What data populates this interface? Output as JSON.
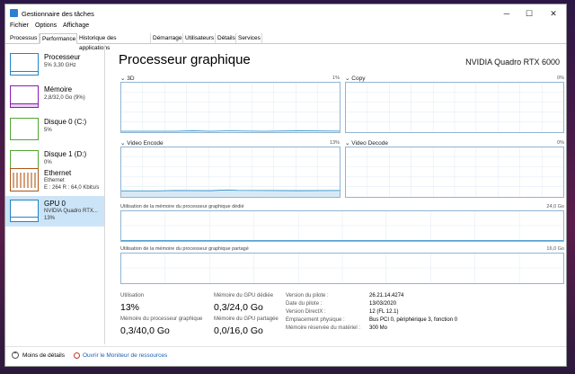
{
  "window": {
    "title": "Gestionnaire des tâches"
  },
  "menu": [
    "Fichier",
    "Options",
    "Affichage"
  ],
  "tabs": [
    "Processus",
    "Performance",
    "Historique des applications",
    "Démarrage",
    "Utilisateurs",
    "Détails",
    "Services"
  ],
  "active_tab": "Performance",
  "sidebar": [
    {
      "name": "Processeur",
      "sub1": "5% 3,30 GHz",
      "sub2": "",
      "sub3": "",
      "color": "#1f86c6"
    },
    {
      "name": "Mémoire",
      "sub1": "2,8/32,0 Go (9%)",
      "sub2": "",
      "sub3": "",
      "color": "#8b1ab8"
    },
    {
      "name": "Disque 0 (C:)",
      "sub1": "5%",
      "sub2": "",
      "sub3": "",
      "color": "#4fa832"
    },
    {
      "name": "Disque 1 (D:)",
      "sub1": "0%",
      "sub2": "",
      "sub3": "",
      "color": "#4fa832"
    },
    {
      "name": "Ethernet",
      "sub1": "Ethernet",
      "sub2": "E : 264 R : 64,0 Kbits/s",
      "sub3": "",
      "color": "#a8561a"
    },
    {
      "name": "GPU 0",
      "sub1": "NVIDIA Quadro RTX...",
      "sub2": "13%",
      "sub3": "",
      "color": "#1f86c6"
    }
  ],
  "panel": {
    "title": "Processeur graphique",
    "model": "NVIDIA Quadro RTX 6000",
    "engines": [
      {
        "label": "3D",
        "pct": "1%"
      },
      {
        "label": "Copy",
        "pct": "0%"
      },
      {
        "label": "Video Encode",
        "pct": "13%"
      },
      {
        "label": "Video Decode",
        "pct": "0%"
      }
    ],
    "dedicated_label": "Utilisation de la mémoire du processeur graphique dédié",
    "dedicated_max": "24,0 Go",
    "shared_label": "Utilisation de la mémoire du processeur graphique partagé",
    "shared_max": "16,0 Go"
  },
  "stats": {
    "utilisation_label": "Utilisation",
    "utilisation_value": "13%",
    "gpu_mem_label": "Mémoire du processeur graphique",
    "gpu_mem_value": "0,3/40,0 Go",
    "dedicated_label": "Mémoire du GPU dédiée",
    "dedicated_value": "0,3/24,0 Go",
    "shared_label": "Mémoire du GPU partagée",
    "shared_value": "0,0/16,0 Go"
  },
  "details": [
    {
      "k": "Version du pilote :",
      "v": "26.21.14.4274"
    },
    {
      "k": "Date du pilote :",
      "v": "13/03/2020"
    },
    {
      "k": "Version DirectX :",
      "v": "12 (FL 12.1)"
    },
    {
      "k": "Emplacement physique :",
      "v": "Bus PCI 0, périphérique 3, fonction 0"
    },
    {
      "k": "Mémoire réservée du matériel :",
      "v": "300 Mo"
    }
  ],
  "footer": {
    "less_details": "Moins de détails",
    "open_monitor": "Ouvrir le Moniteur de ressources"
  },
  "icons": {
    "app": "task-manager-icon",
    "minimize": "minimize-icon",
    "maximize": "maximize-icon",
    "close": "close-icon",
    "chevron": "chevron-up-icon",
    "monitor": "resource-monitor-icon"
  },
  "colors": {
    "accent": "#1f86c6",
    "selected_bg": "#cce4f7",
    "graph_border": "#8fb4d4"
  }
}
